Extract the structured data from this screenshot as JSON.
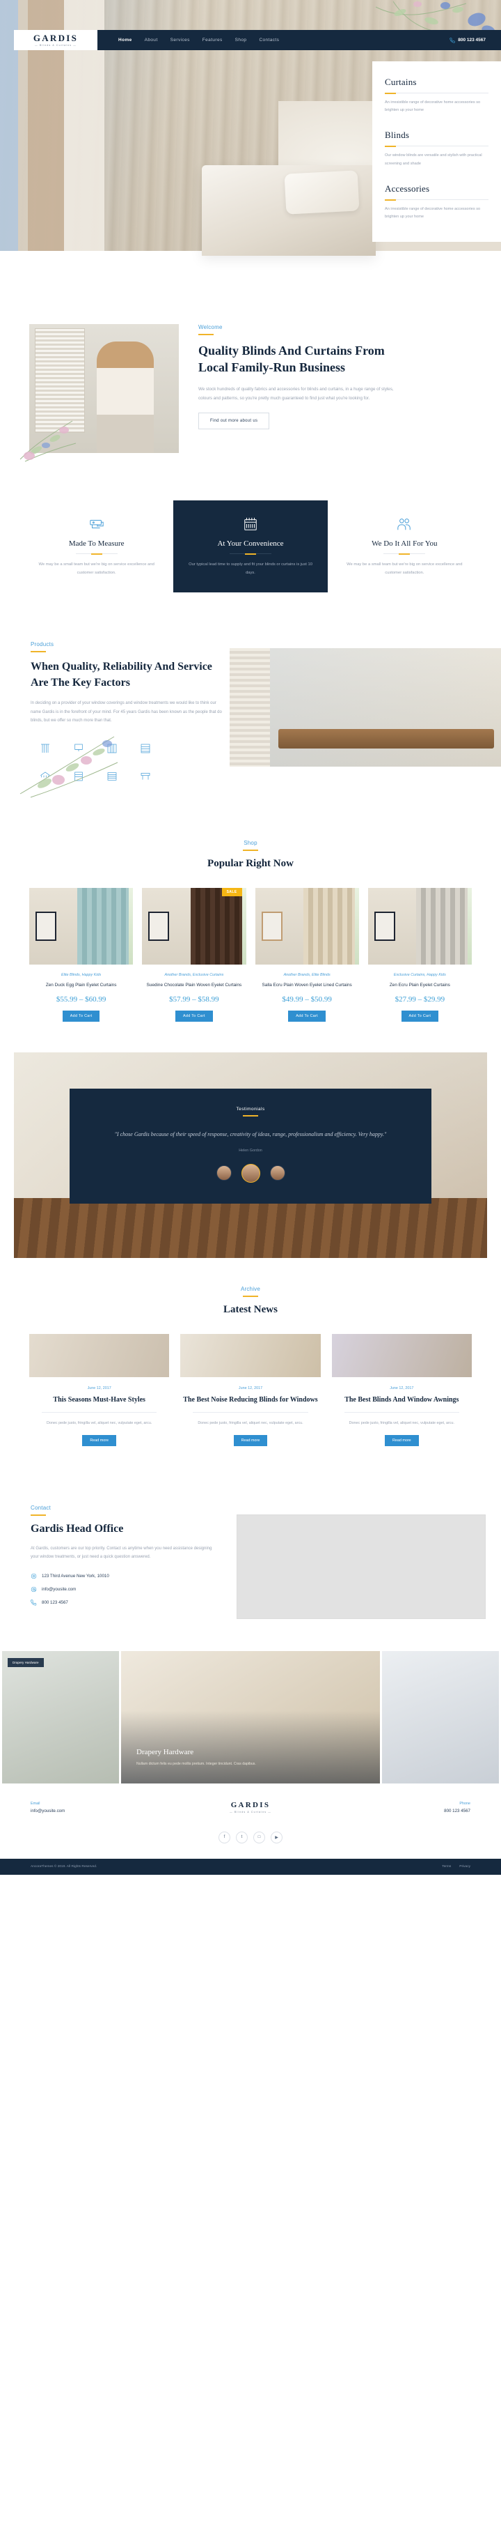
{
  "brand": {
    "name": "GARDIS",
    "tagline": "— Blinds & Curtains —"
  },
  "nav": {
    "items": [
      {
        "label": "Home",
        "active": true
      },
      {
        "label": "About",
        "active": false
      },
      {
        "label": "Services",
        "active": false
      },
      {
        "label": "Features",
        "active": false
      },
      {
        "label": "Shop",
        "active": false
      },
      {
        "label": "Contacts",
        "active": false
      }
    ],
    "phone": "800 123 4567",
    "phone_icon": "phone-icon"
  },
  "hero_services": [
    {
      "title": "Curtains",
      "text": "An irresistible range of decorative home accessories so brighten up your home"
    },
    {
      "title": "Blinds",
      "text": "Our window blinds are versatile and stylish with practical screening and shade"
    },
    {
      "title": "Accessories",
      "text": "An irresistible range of decorative home accessories so brighten up your home"
    }
  ],
  "welcome": {
    "eyebrow": "Welcome",
    "heading": "Quality Blinds And Curtains From Local Family-Run Business",
    "paragraph": "We stock hundreds of quality fabrics and accessories for blinds and curtains, in a huge range of styles, colours and patterns, so you're pretty much guaranteed to find just what you're looking for.",
    "button": "Find out more about us"
  },
  "features": [
    {
      "icon": "sewing-machine-icon",
      "title": "Made To Measure",
      "text": "We may be a small team but we're big on service excellence and customer satisfaction.",
      "dark": false
    },
    {
      "icon": "calendar-icon",
      "title": "At Your Convenience",
      "text": "Our typical lead time to supply and fit your blinds or curtains is just 10 days.",
      "dark": true
    },
    {
      "icon": "people-icon",
      "title": "We Do It All For You",
      "text": "We may be a small team but we're big on service excellence and customer satisfaction.",
      "dark": false
    }
  ],
  "products": {
    "eyebrow": "Products",
    "heading": "When Quality, Reliability And Service Are The Key Factors",
    "paragraph": "In deciding on a provider of your window coverings and window treatments we would like to think our name Gardis is in the forefront of your mind. For 45 years Gardis has been known as the people that do blinds, but we offer so much more than that.",
    "icons": [
      "curtain-icon",
      "roller-blind-icon",
      "vertical-blind-icon",
      "shutter-icon",
      "awning-icon",
      "roman-blind-icon",
      "venetian-blind-icon",
      "pelmet-icon"
    ]
  },
  "shop": {
    "eyebrow": "Shop",
    "heading": "Popular Right Now",
    "add_to_cart": "Add To Cart",
    "products": [
      {
        "badge": "",
        "category": "Elite Blinds, Happy Kids",
        "name": "Zen Duck Egg Plain Eyelet Curtains",
        "price": "$55.99 – $60.99"
      },
      {
        "badge": "SALE",
        "category": "Another Brands, Exclusive Curtains",
        "name": "Suedine Chocolate Plain Woven Eyelet Curtains",
        "price": "$57.99 – $58.99"
      },
      {
        "badge": "",
        "category": "Another Brands, Elite Blinds",
        "name": "Salla Ecru Plain Woven Eyelet Lined Curtains",
        "price": "$49.99 – $50.99"
      },
      {
        "badge": "",
        "category": "Exclusive Curtains, Happy Kids",
        "name": "Zen Ecru Plain Eyelet Curtains",
        "price": "$27.99 – $29.99"
      }
    ]
  },
  "testimonials": {
    "label": "Testimonials",
    "quote": "\"I chose Gardis because of their speed of response, creativity of ideas, range, professionalism and efficiency. Very happy.\"",
    "author": "Helen Gordon",
    "avatars": [
      "avatar-1",
      "avatar-2",
      "avatar-3"
    ]
  },
  "news": {
    "eyebrow": "Archive",
    "heading": "Latest News",
    "read_more": "Read more",
    "posts": [
      {
        "date": "June 12, 2017",
        "title": "This Seasons Must-Have Styles",
        "text": "Donec pede justo, fringilla vel, aliquet nec, vulputate eget, arcu."
      },
      {
        "date": "June 12, 2017",
        "title": "The Best Noise Reducing Blinds for Windows",
        "text": "Donec pede justo, fringilla vel, aliquet nec, vulputate eget, arcu."
      },
      {
        "date": "June 12, 2017",
        "title": "The Best Blinds And Window Awnings",
        "text": "Donec pede justo, fringilla vel, aliquet nec, vulputate eget, arcu."
      }
    ]
  },
  "contact": {
    "eyebrow": "Contact",
    "heading": "Gardis Head Office",
    "paragraph": "At Gardis, customers are our top priority. Contact us anytime when you need assistance designing your window treatments, or just need a quick question answered.",
    "address": "123 Third Avenue New York, 10010",
    "address_icon": "location-icon",
    "email": "info@yousite.com",
    "email_icon": "mail-icon",
    "phone": "800 123 4567",
    "phone_icon": "phone-icon"
  },
  "gallery": {
    "tag": "Drapery Hardware",
    "title": "Drapery Hardware",
    "subtitle": "Nullam dictum felis eu pede mollis pretium. Integer tincidunt. Cras dapibus."
  },
  "footer": {
    "email_label": "Email",
    "email": "info@yousite.com",
    "phone_label": "Phone",
    "phone": "800 123 4567",
    "logo": "GARDIS",
    "logo_sub": "— Blinds & Curtains —",
    "social": [
      {
        "name": "facebook-icon",
        "glyph": "f"
      },
      {
        "name": "twitter-icon",
        "glyph": "t"
      },
      {
        "name": "instagram-icon",
        "glyph": "□"
      },
      {
        "name": "youtube-icon",
        "glyph": "▶"
      }
    ],
    "copyright": "AncoraThemes © 2019. All Rights Reserved.",
    "links": [
      "Terms",
      "Privacy"
    ]
  },
  "colors": {
    "navy": "#15293f",
    "blue": "#3d9fd6",
    "yellow": "#f0b429",
    "muted": "#9aa3b2"
  }
}
